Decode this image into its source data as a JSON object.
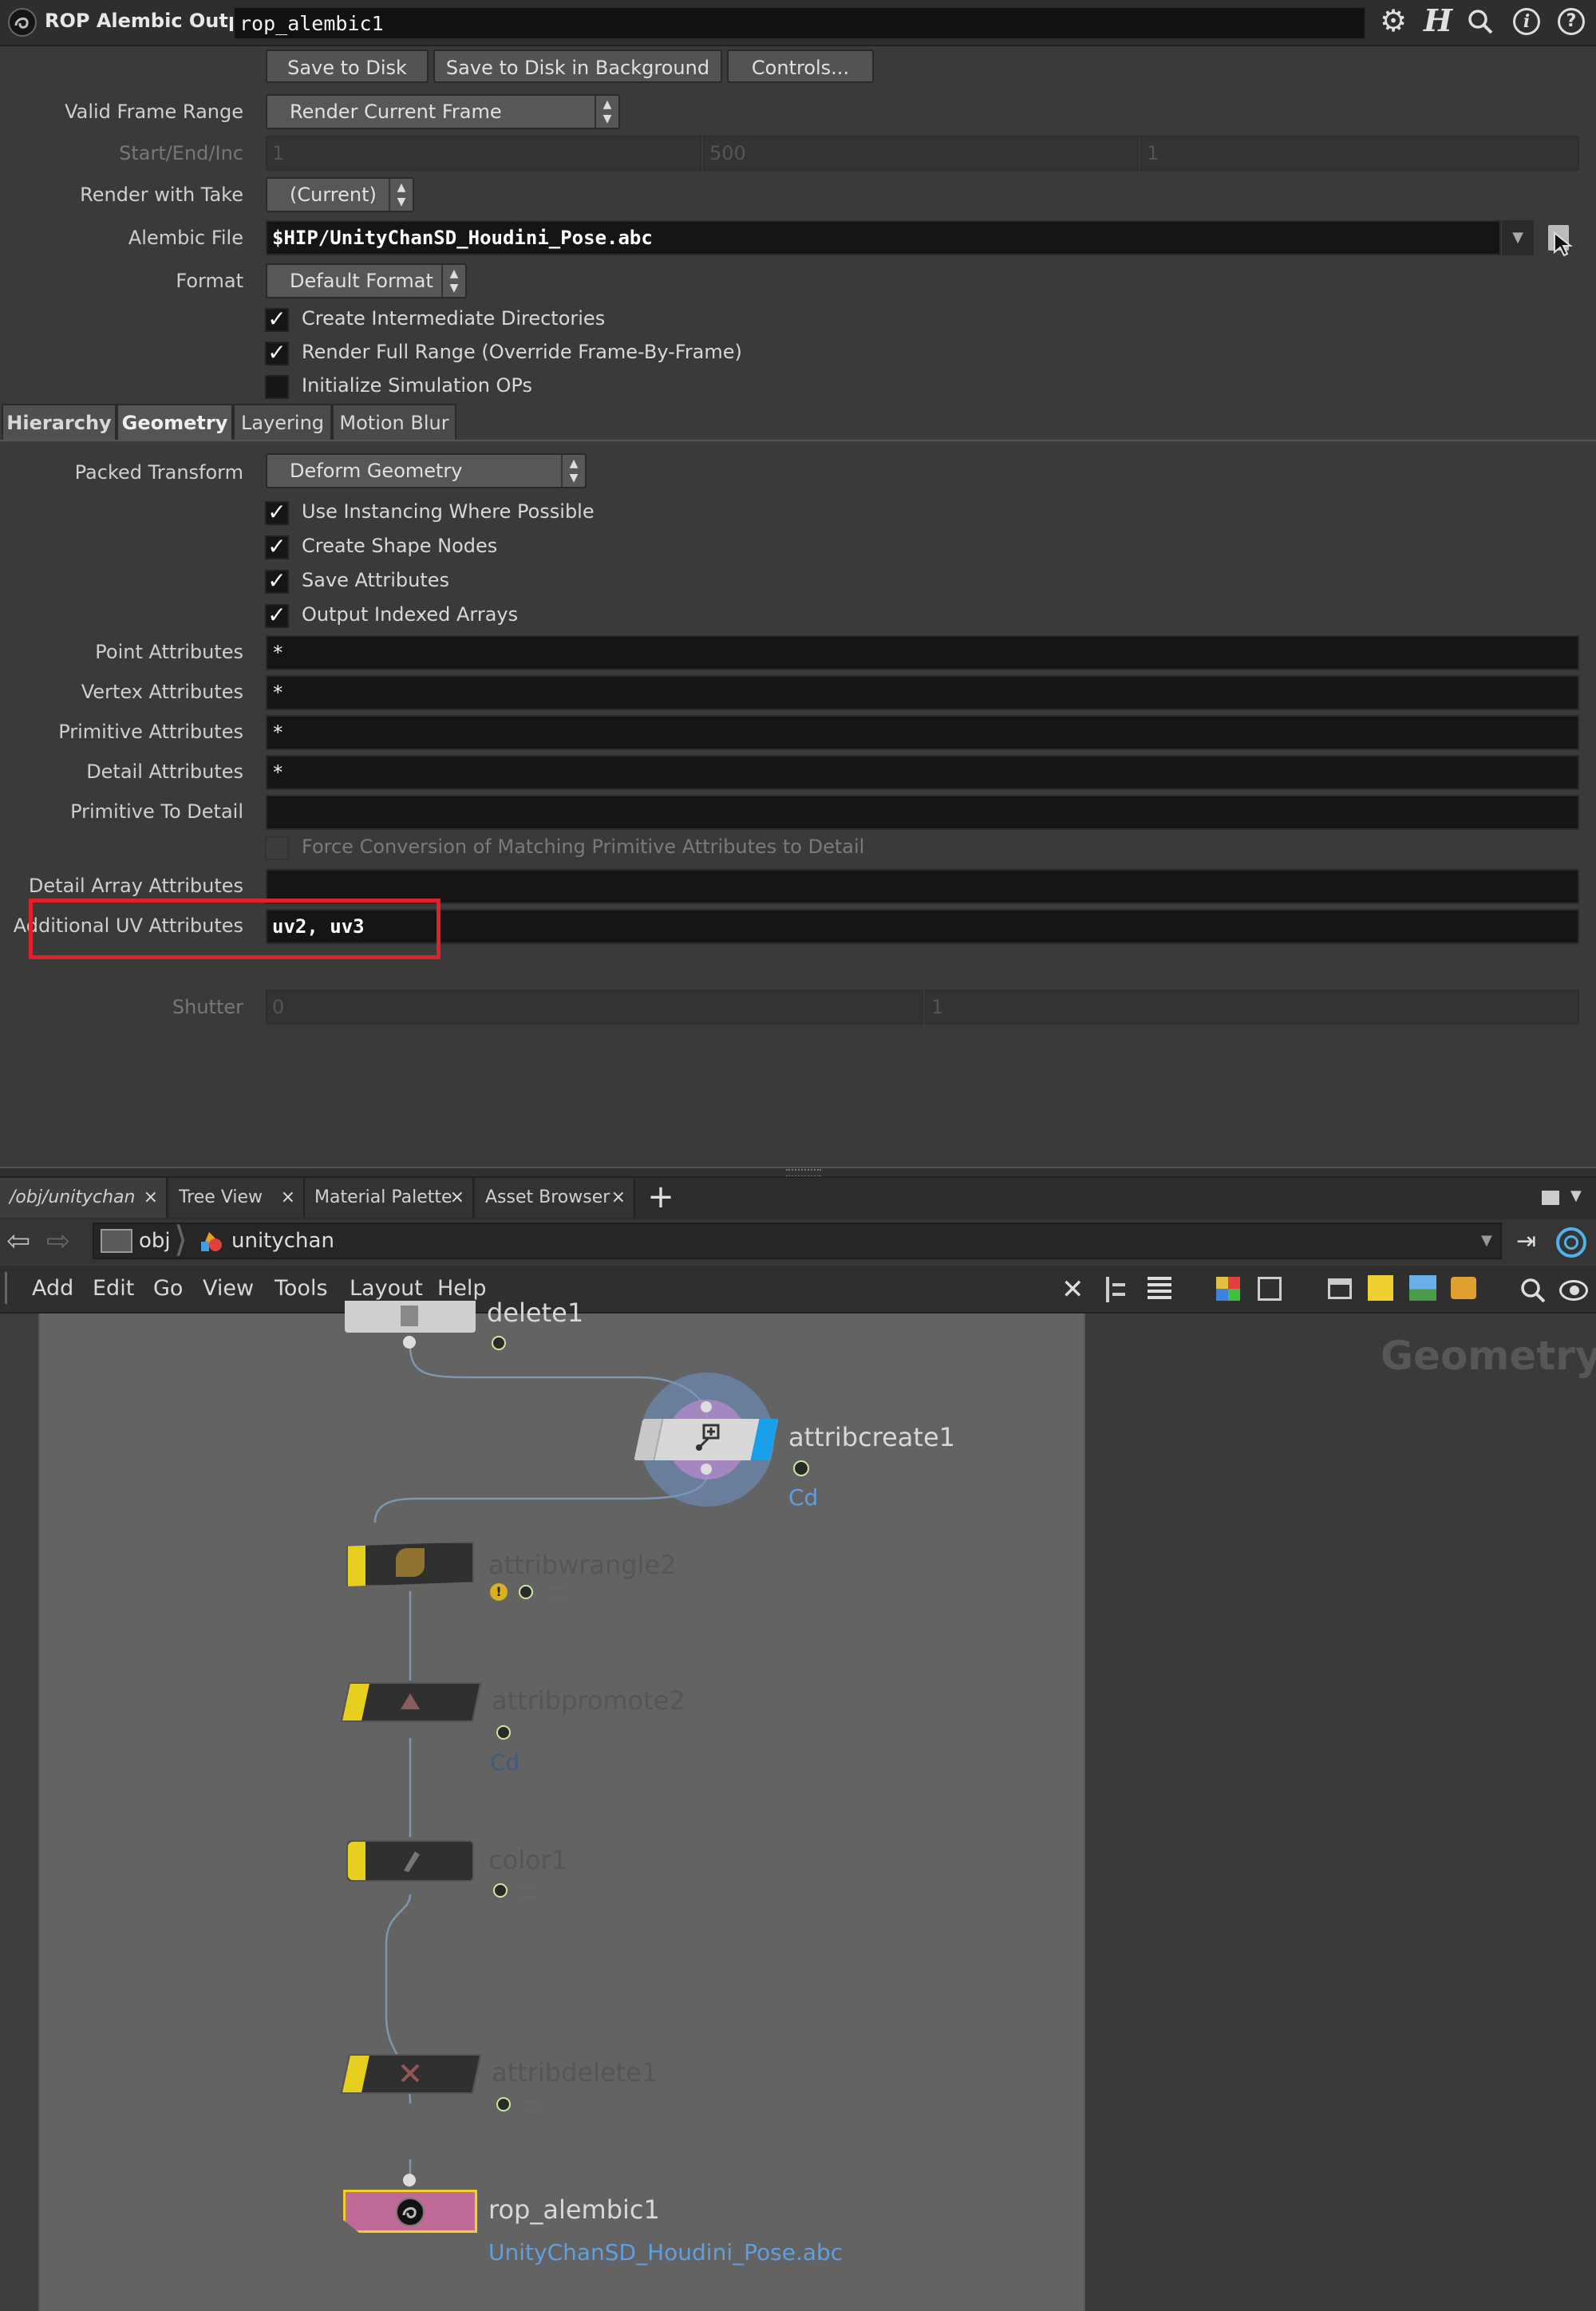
{
  "header": {
    "node_type": "ROP Alembic Output",
    "node_name": "rop_alembic1"
  },
  "actions": {
    "save": "Save to Disk",
    "save_bg": "Save to Disk in Background",
    "controls": "Controls..."
  },
  "params": {
    "valid_frame_range": {
      "label": "Valid Frame Range",
      "value": "Render Current Frame"
    },
    "start_end_inc": {
      "label": "Start/End/Inc",
      "values": [
        "1",
        "500",
        "1"
      ]
    },
    "render_with_take": {
      "label": "Render with Take",
      "value": "(Current)"
    },
    "alembic_file": {
      "label": "Alembic File",
      "value": "$HIP/UnityChanSD_Houdini_Pose.abc"
    },
    "format": {
      "label": "Format",
      "value": "Default Format"
    },
    "checks": [
      {
        "label": "Create Intermediate Directories",
        "checked": true
      },
      {
        "label": "Render Full Range (Override Frame-By-Frame)",
        "checked": true
      },
      {
        "label": "Initialize Simulation OPs",
        "checked": false
      }
    ]
  },
  "tabs": [
    "Hierarchy",
    "Geometry",
    "Layering",
    "Motion Blur"
  ],
  "geometry": {
    "packed_transform": {
      "label": "Packed Transform",
      "value": "Deform Geometry"
    },
    "checks": [
      {
        "label": "Use Instancing Where Possible",
        "checked": true
      },
      {
        "label": "Create Shape Nodes",
        "checked": true
      },
      {
        "label": "Save Attributes",
        "checked": true
      },
      {
        "label": "Output Indexed Arrays",
        "checked": true
      }
    ],
    "point_attributes": {
      "label": "Point Attributes",
      "value": "*"
    },
    "vertex_attributes": {
      "label": "Vertex Attributes",
      "value": "*"
    },
    "primitive_attributes": {
      "label": "Primitive Attributes",
      "value": "*"
    },
    "detail_attributes": {
      "label": "Detail Attributes",
      "value": "*"
    },
    "primitive_to_detail": {
      "label": "Primitive To Detail",
      "value": ""
    },
    "force_conversion": {
      "label": "Force Conversion of Matching Primitive Attributes to Detail",
      "checked": false
    },
    "detail_array_attributes": {
      "label": "Detail Array Attributes",
      "value": ""
    },
    "additional_uv": {
      "label": "Additional UV Attributes",
      "value": "uv2, uv3"
    }
  },
  "motion_blur": {
    "shutter": {
      "label": "Shutter",
      "values": [
        "0",
        "1"
      ]
    }
  },
  "highlight_color": "#e0202a",
  "pane_tabs": [
    {
      "label": "/obj/unitychan"
    },
    {
      "label": "Tree View"
    },
    {
      "label": "Material Palette"
    },
    {
      "label": "Asset Browser"
    }
  ],
  "path": {
    "root": "obj",
    "current": "unitychan"
  },
  "network_menu": [
    "Add",
    "Edit",
    "Go",
    "View",
    "Tools",
    "Layout",
    "Help"
  ],
  "network_context": "Geometry",
  "nodes": {
    "delete1": {
      "name": "delete1"
    },
    "attribcreate1": {
      "name": "attribcreate1",
      "sub": "Cd"
    },
    "attribwrangle2": {
      "name": "attribwrangle2"
    },
    "attribpromote2": {
      "name": "attribpromote2",
      "sub": "Cd"
    },
    "color1": {
      "name": "color1"
    },
    "attribdelete1": {
      "name": "attribdelete1"
    },
    "rop_alembic1": {
      "name": "rop_alembic1",
      "sub": "UnityChanSD_Houdini_Pose.abc"
    }
  }
}
